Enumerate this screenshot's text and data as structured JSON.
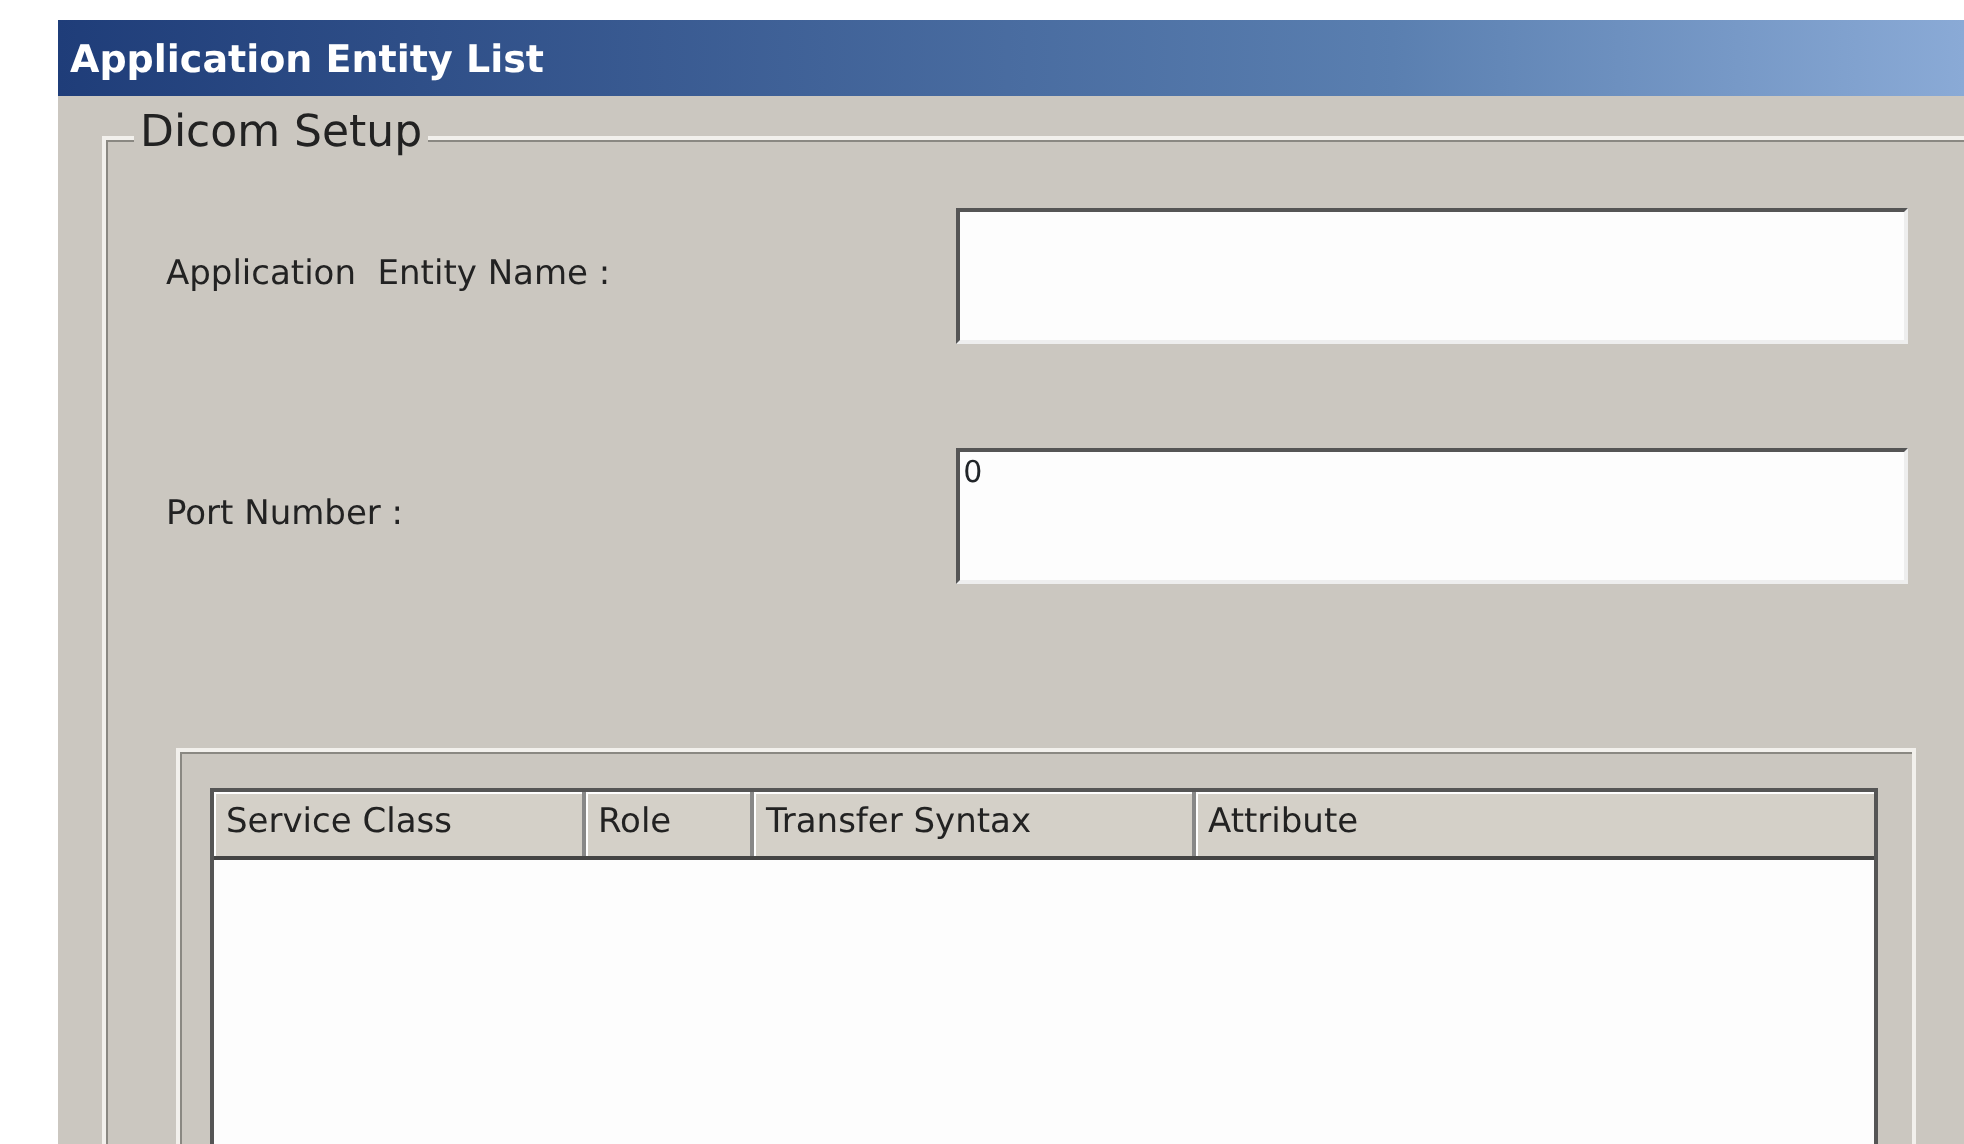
{
  "window": {
    "title": "Application Entity List"
  },
  "group": {
    "title": "Dicom Setup"
  },
  "fields": [
    {
      "label": "Application  Entity Name :"
    },
    {
      "label": "Port Number :",
      "value": "0"
    }
  ],
  "table": {
    "columns": [
      "Service Class",
      "Role",
      "Transfer Syntax",
      "Attribute"
    ]
  }
}
